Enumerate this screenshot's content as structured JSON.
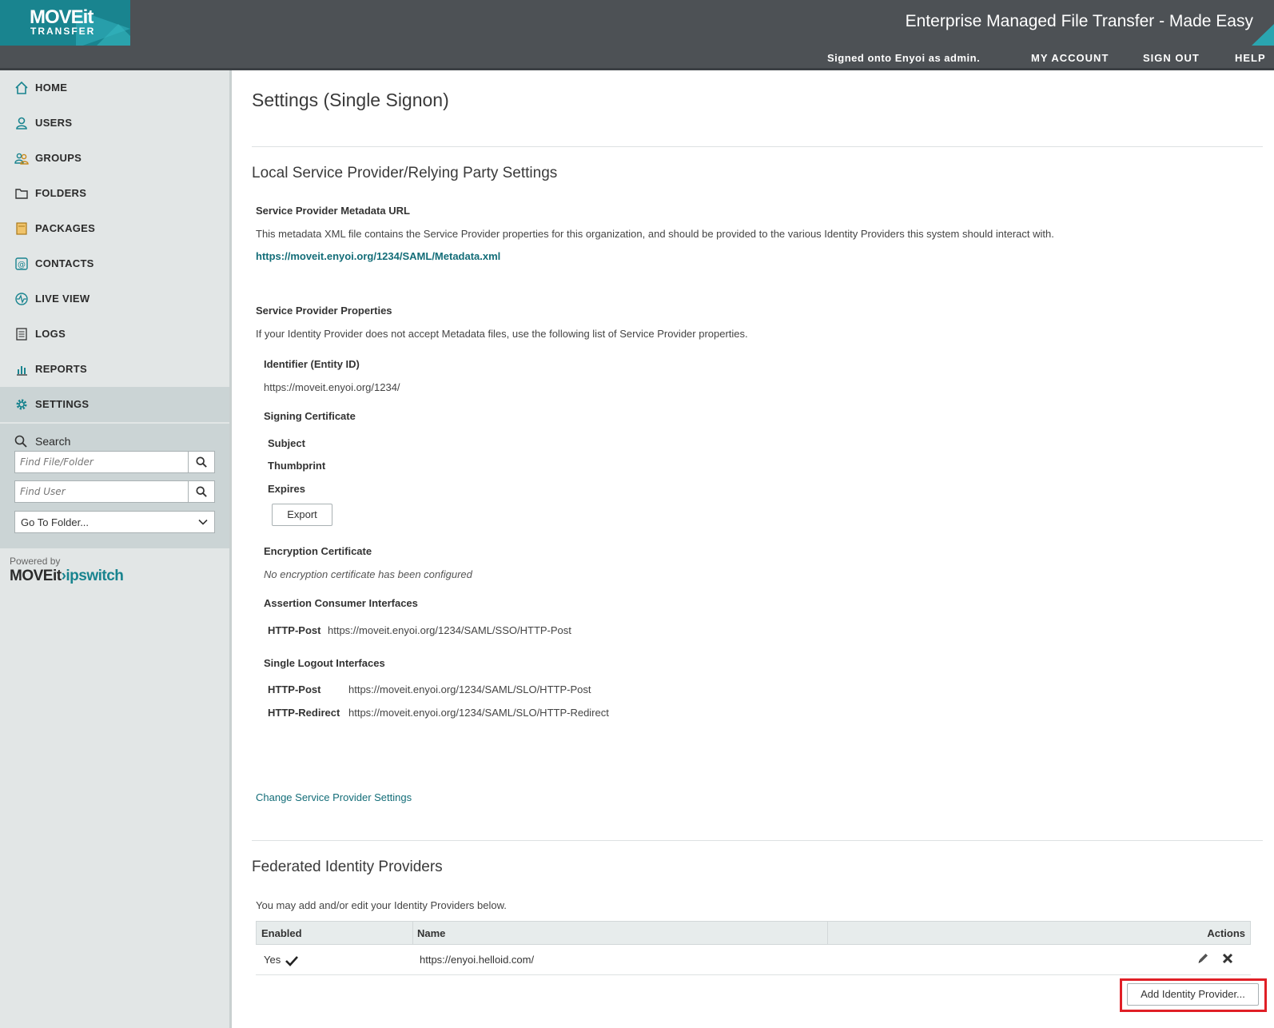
{
  "header": {
    "logo_line1": "MOVEit",
    "logo_line2": "TRANSFER",
    "tagline": "Enterprise Managed File Transfer - Made Easy",
    "signed_in": "Signed onto Enyoi as admin.",
    "nav": [
      "MY ACCOUNT",
      "SIGN OUT",
      "HELP"
    ]
  },
  "sidebar": {
    "items": [
      {
        "label": "HOME",
        "icon": "home-icon"
      },
      {
        "label": "USERS",
        "icon": "user-icon"
      },
      {
        "label": "GROUPS",
        "icon": "group-icon"
      },
      {
        "label": "FOLDERS",
        "icon": "folder-icon"
      },
      {
        "label": "PACKAGES",
        "icon": "package-icon"
      },
      {
        "label": "CONTACTS",
        "icon": "contact-icon"
      },
      {
        "label": "LIVE VIEW",
        "icon": "live-view-icon"
      },
      {
        "label": "LOGS",
        "icon": "log-icon"
      },
      {
        "label": "REPORTS",
        "icon": "report-icon"
      },
      {
        "label": "SETTINGS",
        "icon": "gear-icon"
      }
    ],
    "active": "SETTINGS",
    "search_title": "Search",
    "find_file_placeholder": "Find File/Folder",
    "find_user_placeholder": "Find User",
    "goto_folder": "Go To Folder...",
    "powered_by": "Powered by",
    "brand_moveit": "MOVEit",
    "brand_arrow": "›",
    "brand_ipswitch": "ipswitch"
  },
  "page": {
    "title": "Settings (Single Signon)",
    "sp_section_title": "Local Service Provider/Relying Party Settings",
    "metadata_label": "Service Provider Metadata URL",
    "metadata_desc": "This metadata XML file contains the Service Provider properties for this organization, and should be provided to the various Identity Providers this system should interact with.",
    "metadata_url": "https://moveit.enyoi.org/1234/SAML/Metadata.xml",
    "props_label": "Service Provider Properties",
    "props_desc": "If your Identity Provider does not accept Metadata files, use the following list of Service Provider properties.",
    "entity_id_label": "Identifier (Entity ID)",
    "entity_id_value": "https://moveit.enyoi.org/1234/",
    "signing_cert_label": "Signing Certificate",
    "subject_label": "Subject",
    "thumbprint_label": "Thumbprint",
    "expires_label": "Expires",
    "export_button": "Export",
    "encryption_cert_label": "Encryption Certificate",
    "encryption_cert_value": "No encryption certificate has been configured",
    "acs_label": "Assertion Consumer Interfaces",
    "acs_binding": "HTTP-Post",
    "acs_url": "https://moveit.enyoi.org/1234/SAML/SSO/HTTP-Post",
    "slo_label": "Single Logout Interfaces",
    "slo": [
      {
        "binding": "HTTP-Post",
        "url": "https://moveit.enyoi.org/1234/SAML/SLO/HTTP-Post"
      },
      {
        "binding": "HTTP-Redirect",
        "url": "https://moveit.enyoi.org/1234/SAML/SLO/HTTP-Redirect"
      }
    ],
    "change_sp_link": "Change Service Provider Settings",
    "idp_section_title": "Federated Identity Providers",
    "idp_desc": "You may add and/or edit your Identity Providers below.",
    "table": {
      "headers": [
        "Enabled",
        "Name",
        "Actions"
      ],
      "rows": [
        {
          "enabled": "Yes",
          "name": "https://enyoi.helloid.com/"
        }
      ]
    },
    "add_idp_button": "Add Identity Provider..."
  },
  "colors": {
    "header_bg": "#4d5155",
    "brand_teal": "#19848f",
    "sidebar_bg": "#e2e6e6",
    "sidebar_active_bg": "#cbd4d5",
    "link": "#136d78",
    "highlight": "#e01f26"
  }
}
